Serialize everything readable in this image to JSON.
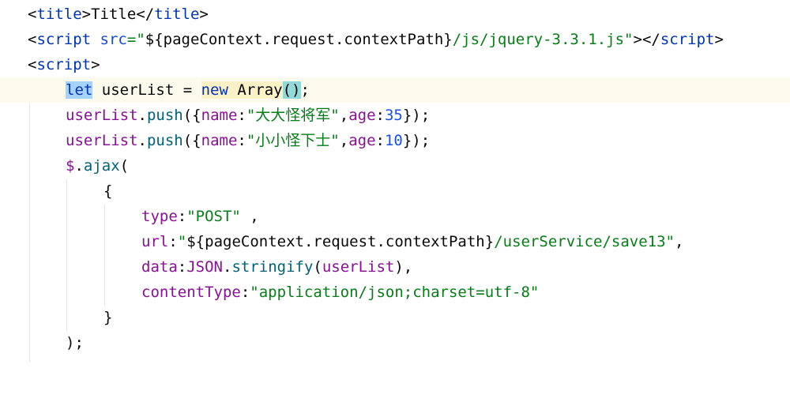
{
  "lines": [
    {
      "a": "<",
      "b": "title",
      "c": ">",
      "d": "Title",
      "e": "</",
      "f": "title",
      "g": ">"
    },
    {
      "a": "<",
      "b": "script",
      "c": " ",
      "d": "src",
      "e": "=\"",
      "f": "${",
      "g": "pageContext.request.contextPath",
      "h": "}",
      "i": "/js/jquery-3.3.1.js\"",
      "j": "></",
      "k": "script",
      "l": ">"
    },
    {
      "a": "<",
      "b": "script",
      "c": ">"
    },
    {
      "a": "let",
      "b": " userList = ",
      "c": "new",
      "d": " ",
      "e": "Array",
      "f": "(",
      "g": ")",
      "h": ";"
    },
    {
      "a": "userList",
      "b": ".",
      "c": "push",
      "d": "({",
      "e": "name",
      "f": ":",
      "g": "\"大大怪将军\"",
      "h": ",",
      "i": "age",
      "j": ":",
      "k": "35",
      "l": "});"
    },
    {
      "a": "userList",
      "b": ".",
      "c": "push",
      "d": "({",
      "e": "name",
      "f": ":",
      "g": "\"小小怪下士\"",
      "h": ",",
      "i": "age",
      "j": ":",
      "k": "10",
      "l": "});"
    },
    {
      "a": "$",
      "b": ".",
      "c": "ajax",
      "d": "("
    },
    {
      "a": "{"
    },
    {
      "a": "type",
      "b": ":",
      "c": "\"POST\"",
      "d": " ,"
    },
    {
      "a": "url",
      "b": ":",
      "c": "\"",
      "d": "${",
      "e": "pageContext.request.contextPath",
      "f": "}",
      "g": "/userService/save13\"",
      "h": ","
    },
    {
      "a": "data",
      "b": ":",
      "c": "JSON",
      "d": ".",
      "e": "stringify",
      "f": "(",
      "g": "userList",
      "h": "),"
    },
    {
      "a": "contentType",
      "b": ":",
      "c": "\"application/json;charset=utf-8\""
    },
    {
      "a": "}"
    },
    {
      "a": ");"
    }
  ]
}
